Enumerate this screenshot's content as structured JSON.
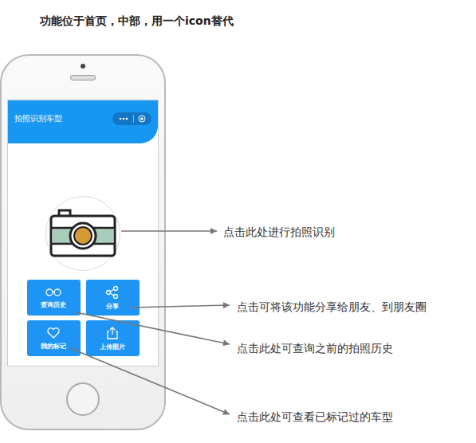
{
  "heading": "功能位于首页，中部，用一个icon替代",
  "phone": {
    "header_title": "拍照识别车型",
    "buttons": [
      {
        "label": "查询历史"
      },
      {
        "label": "分享"
      },
      {
        "label": "我的标记"
      },
      {
        "label": "上传图片"
      }
    ]
  },
  "annotations": [
    {
      "text": "点击此处进行拍照识别"
    },
    {
      "text": "点击可将该功能分享给朋友、到朋友圈"
    },
    {
      "text": "点击此处可查询之前的拍照历史"
    },
    {
      "text": "点击此处可查看已标记过的车型"
    }
  ]
}
